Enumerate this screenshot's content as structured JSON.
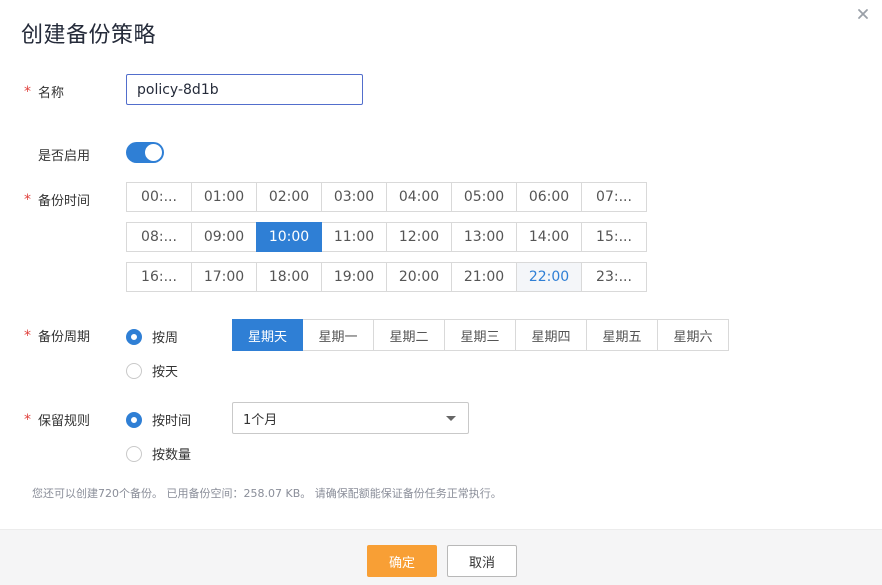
{
  "dialog": {
    "title": "创建备份策略",
    "close_icon": "close-icon"
  },
  "form": {
    "name": {
      "label": "名称",
      "required": true,
      "value": "policy-8d1b"
    },
    "enabled": {
      "label": "是否启用",
      "required": false,
      "on": true
    },
    "backup_time": {
      "label": "备份时间",
      "required": true,
      "rows": [
        [
          "00:...",
          "01:00",
          "02:00",
          "03:00",
          "04:00",
          "05:00",
          "06:00",
          "07:..."
        ],
        [
          "08:...",
          "09:00",
          "10:00",
          "11:00",
          "12:00",
          "13:00",
          "14:00",
          "15:..."
        ],
        [
          "16:...",
          "17:00",
          "18:00",
          "19:00",
          "20:00",
          "21:00",
          "22:00",
          "23:..."
        ]
      ],
      "selected": "10:00",
      "hovered": "22:00"
    },
    "backup_cycle": {
      "label": "备份周期",
      "required": true,
      "option_week": "按周",
      "option_day": "按天",
      "selected_option": "按周",
      "weekdays": [
        "星期天",
        "星期一",
        "星期二",
        "星期三",
        "星期四",
        "星期五",
        "星期六"
      ],
      "selected_weekday": "星期天"
    },
    "retention": {
      "label": "保留规则",
      "required": true,
      "option_time": "按时间",
      "option_count": "按数量",
      "selected_option": "按时间",
      "time_value": "1个月"
    }
  },
  "info_text": "您还可以创建720个备份。 已用备份空间：258.07 KB。 请确保配额能保证备份任务正常执行。",
  "footer": {
    "ok_label": "确定",
    "cancel_label": "取消"
  },
  "colors": {
    "primary": "#2f7fd5",
    "ok_button": "#f89f35",
    "required_star": "#e0413d"
  }
}
